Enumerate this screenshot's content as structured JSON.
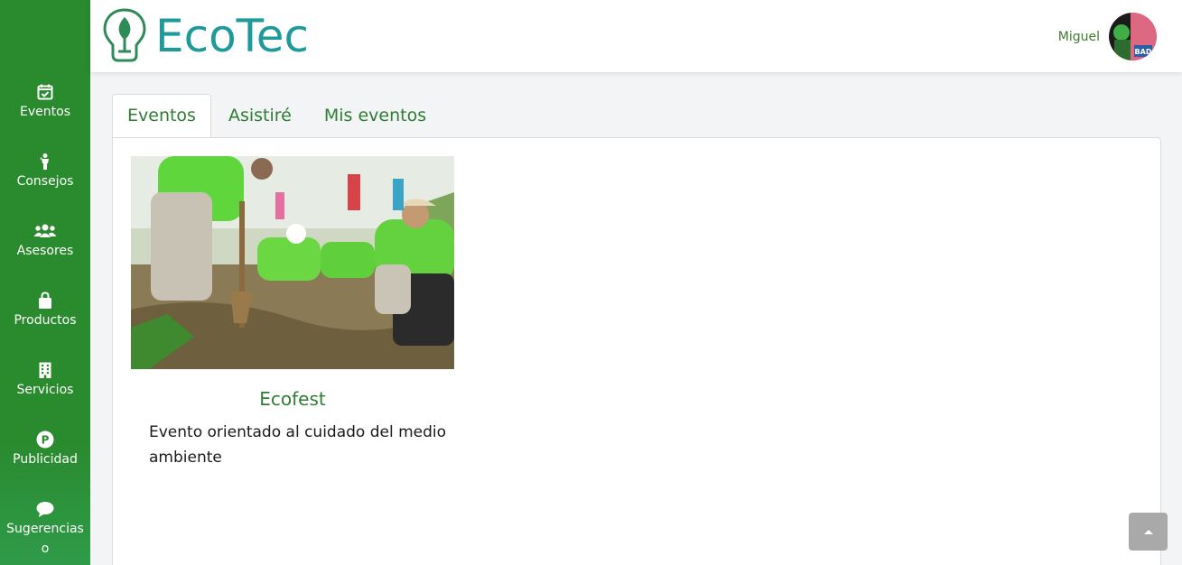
{
  "app": {
    "logo_text": "EcoTec"
  },
  "user": {
    "name": "Miguel"
  },
  "sidebar": {
    "items": [
      {
        "label": "Eventos",
        "icon": "calendar-check-icon"
      },
      {
        "label": "Consejos",
        "icon": "person-icon"
      },
      {
        "label": "Asesores",
        "icon": "users-icon"
      },
      {
        "label": "Productos",
        "icon": "shopping-bag-icon"
      },
      {
        "label": "Servicios",
        "icon": "building-icon"
      },
      {
        "label": "Publicidad",
        "icon": "p-circle-icon"
      },
      {
        "label": "Sugerencias\no",
        "icon": "comment-icon"
      }
    ]
  },
  "tabs": [
    {
      "label": "Eventos",
      "active": true
    },
    {
      "label": "Asistiré",
      "active": false
    },
    {
      "label": "Mis eventos",
      "active": false
    }
  ],
  "events": [
    {
      "title": "Ecofest",
      "description": "Evento orientado al cuidado del medio ambiente",
      "image": "tree-planting-photo"
    }
  ],
  "colors": {
    "sidebar": "#2a8a2e",
    "accent_green": "#2e7d32",
    "logo_teal": "#1f9a9a",
    "scroll_button": "#a9a9a9"
  },
  "icons": {
    "scroll_top": "chevron-up-icon"
  }
}
